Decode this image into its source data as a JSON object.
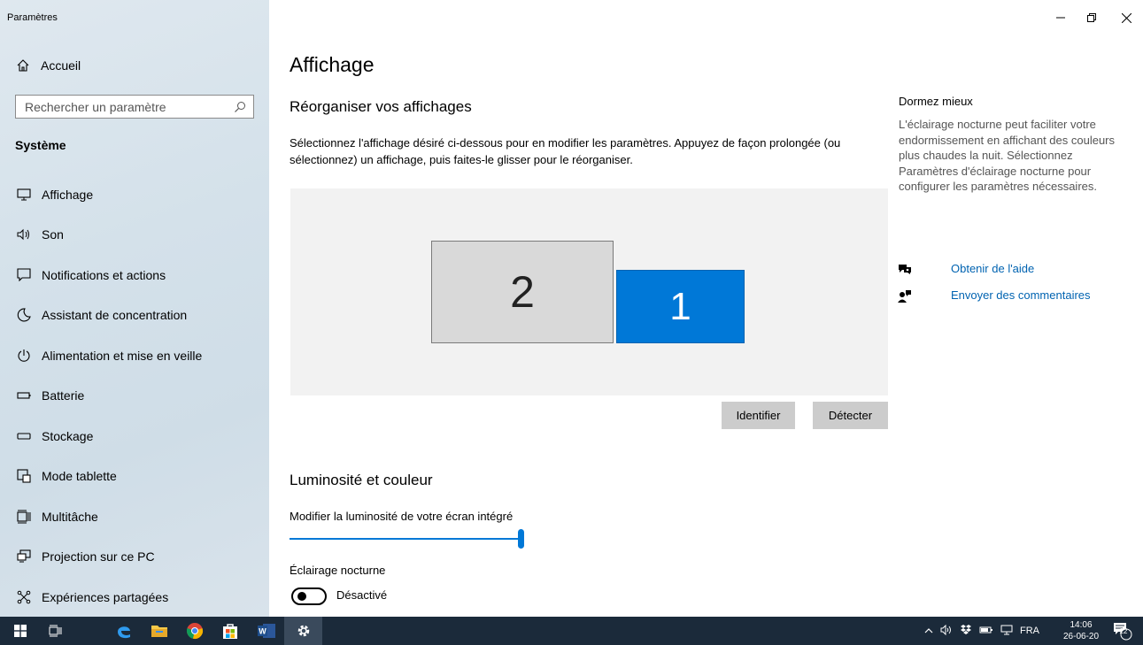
{
  "window": {
    "title": "Paramètres"
  },
  "sidebar": {
    "home": "Accueil",
    "search_placeholder": "Rechercher un paramètre",
    "section": "Système",
    "items": [
      {
        "label": "Affichage",
        "icon": "monitor-icon"
      },
      {
        "label": "Son",
        "icon": "speaker-icon"
      },
      {
        "label": "Notifications et actions",
        "icon": "notification-icon"
      },
      {
        "label": "Assistant de concentration",
        "icon": "moon-icon"
      },
      {
        "label": "Alimentation et mise en veille",
        "icon": "power-icon"
      },
      {
        "label": "Batterie",
        "icon": "battery-icon"
      },
      {
        "label": "Stockage",
        "icon": "storage-icon"
      },
      {
        "label": "Mode tablette",
        "icon": "tablet-icon"
      },
      {
        "label": "Multitâche",
        "icon": "multitask-icon"
      },
      {
        "label": "Projection sur ce PC",
        "icon": "projection-icon"
      },
      {
        "label": "Expériences partagées",
        "icon": "shared-icon"
      }
    ]
  },
  "main": {
    "title": "Affichage",
    "rearrange_heading": "Réorganiser vos affichages",
    "rearrange_desc": "Sélectionnez l'affichage désiré ci-dessous pour en modifier les paramètres. Appuyez de façon prolongée (ou sélectionnez) un affichage, puis faites-le glisser pour le réorganiser.",
    "monitor_2": "2",
    "monitor_1": "1",
    "identify_button": "Identifier",
    "detect_button": "Détecter",
    "brightness_heading": "Luminosité et couleur",
    "brightness_label": "Modifier la luminosité de votre écran intégré",
    "brightness_value": 100,
    "night_light_label": "Éclairage nocturne",
    "night_light_state": "Désactivé"
  },
  "aside": {
    "title": "Dormez mieux",
    "text": "L'éclairage nocturne peut faciliter votre endormissement en affichant des couleurs plus chaudes la nuit. Sélectionnez Paramètres d'éclairage nocturne pour configurer les paramètres nécessaires.",
    "help_link": "Obtenir de l'aide",
    "feedback_link": "Envoyer des commentaires"
  },
  "taskbar": {
    "language": "FRA",
    "time": "14:06",
    "date": "26-06-20",
    "notification_count": "22"
  },
  "colors": {
    "accent": "#0078d7",
    "link": "#0063b1",
    "taskbar": "#1b2a3a"
  }
}
